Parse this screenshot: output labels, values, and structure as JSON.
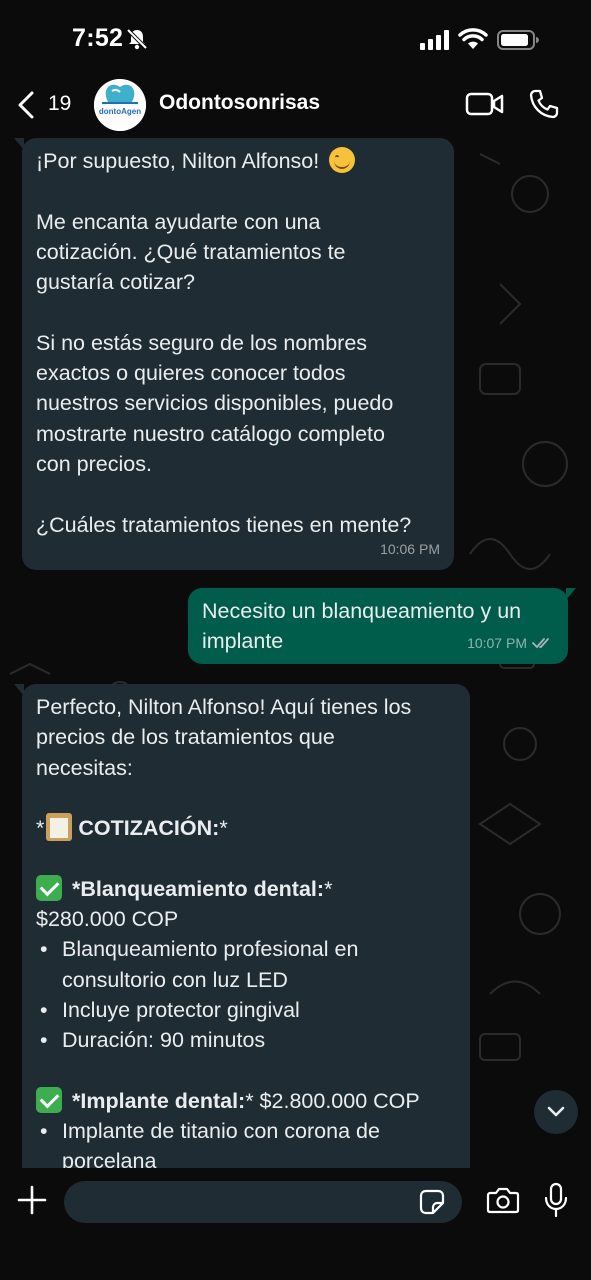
{
  "status_bar": {
    "time": "7:52"
  },
  "header": {
    "unread_count": "19",
    "contact_name": "Odontosonrisas",
    "avatar_text": "dontoAgen"
  },
  "messages": [
    {
      "direction": "incoming",
      "lines": [
        "¡Por supuesto, Nilton Alfonso! ",
        "",
        "Me encanta ayudarte con una",
        "cotización. ¿Qué tratamientos te",
        "gustaría cotizar?",
        "",
        "Si no estás seguro de los nombres",
        "exactos o quieres conocer todos",
        "nuestros servicios disponibles, puedo",
        "mostrarte nuestro catálogo completo",
        "con precios.",
        "",
        "¿Cuáles tratamientos tienes en mente?"
      ],
      "time": "10:06 PM"
    },
    {
      "direction": "outgoing",
      "lines": [
        "Necesito un blanqueamiento y un",
        "implante"
      ],
      "time": "10:07 PM"
    },
    {
      "direction": "incoming",
      "intro": [
        "Perfecto, Nilton Alfonso! Aquí tienes los",
        "precios de los tratamientos que",
        "necesitas:"
      ],
      "heading_prefix": "*",
      "heading": "COTIZACIÓN:",
      "heading_suffix": "*",
      "item1_title": "*Blanqueamiento dental:",
      "item1_star": "*",
      "item1_price": "$280.000 COP",
      "item1_bullets": [
        [
          "Blanqueamiento profesional en",
          "consultorio con luz LED"
        ],
        [
          "Incluye protector gingival"
        ],
        [
          "Duración: 90 minutos"
        ]
      ],
      "item2_title": "*Implante dental:",
      "item2_rest": "* $2.800.000 COP",
      "item2_bullets": [
        [
          "Implante de titanio con corona de"
        ]
      ],
      "cut_line": "porcelana"
    }
  ],
  "input": {
    "placeholder": ""
  },
  "colors": {
    "incoming_bubble": "#202c33",
    "outgoing_bubble": "#005c4b",
    "background": "#0b0b0b"
  }
}
